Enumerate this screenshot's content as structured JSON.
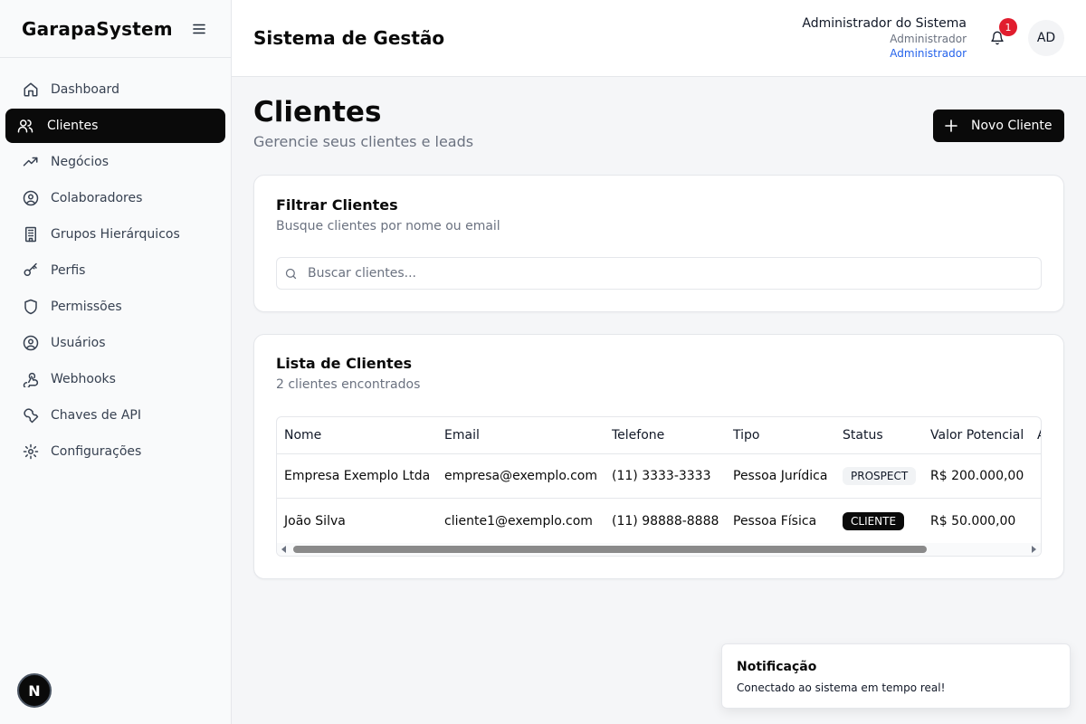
{
  "sidebar": {
    "brand": "GarapaSystem",
    "items": [
      {
        "label": "Dashboard",
        "icon": "home-icon",
        "active": false
      },
      {
        "label": "Clientes",
        "icon": "users-icon",
        "active": true
      },
      {
        "label": "Negócios",
        "icon": "trending-up-icon",
        "active": false
      },
      {
        "label": "Colaboradores",
        "icon": "user-circle-icon",
        "active": false
      },
      {
        "label": "Grupos Hierárquicos",
        "icon": "building-icon",
        "active": false
      },
      {
        "label": "Perfis",
        "icon": "key-icon",
        "active": false
      },
      {
        "label": "Permissões",
        "icon": "shield-icon",
        "active": false
      },
      {
        "label": "Usuários",
        "icon": "user-circle-icon",
        "active": false
      },
      {
        "label": "Webhooks",
        "icon": "webhook-icon",
        "active": false
      },
      {
        "label": "Chaves de API",
        "icon": "wrench-icon",
        "active": false
      },
      {
        "label": "Configurações",
        "icon": "gear-icon",
        "active": false
      }
    ],
    "footer_logo": "N"
  },
  "header": {
    "title": "Sistema de Gestão",
    "user_name": "Administrador do Sistema",
    "user_role": "Administrador",
    "user_role_link": "Administrador",
    "notification_count": "1",
    "avatar_initials": "AD"
  },
  "page": {
    "title": "Clientes",
    "subtitle": "Gerencie seus clientes e leads",
    "new_button": "Novo Cliente"
  },
  "filter": {
    "title": "Filtrar Clientes",
    "subtitle": "Busque clientes por nome ou email",
    "search_placeholder": "Buscar clientes..."
  },
  "list": {
    "title": "Lista de Clientes",
    "subtitle": "2 clientes encontrados",
    "columns": [
      "Nome",
      "Email",
      "Telefone",
      "Tipo",
      "Status",
      "Valor Potencial",
      "A"
    ],
    "rows": [
      {
        "nome": "Empresa Exemplo Ltda",
        "email": "empresa@exemplo.com",
        "telefone": "(11) 3333-3333",
        "tipo": "Pessoa Jurídica",
        "status": "PROSPECT",
        "valor": "R$ 200.000,00"
      },
      {
        "nome": "João Silva",
        "email": "cliente1@exemplo.com",
        "telefone": "(11) 98888-8888",
        "tipo": "Pessoa Física",
        "status": "CLIENTE",
        "valor": "R$ 50.000,00"
      }
    ]
  },
  "toast": {
    "title": "Notificação",
    "message": "Conectado ao sistema em tempo real!"
  },
  "colors": {
    "primary": "#0a0a0a",
    "badge_red": "#e11d2e",
    "link_blue": "#2563eb"
  }
}
